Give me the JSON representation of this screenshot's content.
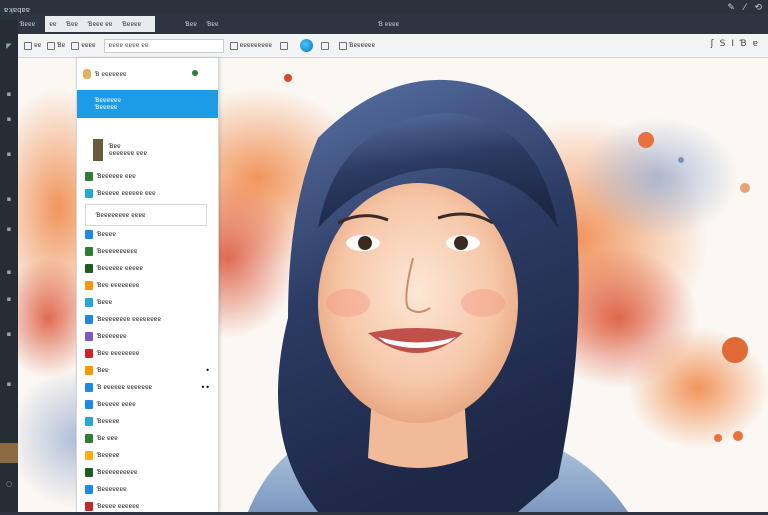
{
  "app": {
    "title": "ɐʞɐqɐɐ"
  },
  "menubar": {
    "items": [
      "Ɓɐɐɐ",
      "Ɓɐɐ",
      "Ɓɐɐ"
    ],
    "tabs": [
      "ɐɐ",
      "Ɓɐɐ",
      "Ɓɐɐɐ ɐɐ",
      "Ɓɐɐɐɐ"
    ],
    "extra": "Ɓ ɐɐɐɐ"
  },
  "toolbar": {
    "items": [
      "ɐɐ",
      "Ɓɐ",
      "ɐɐɐɐ",
      "ɐɐɐɐɐɐɐɐɐ",
      "Ɓɐɐɐɐɐɐ"
    ],
    "search_value": "ɐɐɐɐ ɐɐɐɐ ɐɐ",
    "right_icons": [
      "ʃ",
      "S",
      "I",
      "Ɓ",
      "ɐ"
    ]
  },
  "layers": {
    "header": "Ɓ ɐɐɐɐɐɐɐ",
    "selected": {
      "line1": "Ɓɐɐɐɐɐɐ",
      "line2": "Ɓɐɐɐɐɐ"
    },
    "group": {
      "line1": "Ɓɐɐ",
      "line2": "ɐɐɐɐɐɐɐ ɐɐɐ"
    },
    "rows": [
      {
        "label": "Ɓɐɐɐɐɐɐ ɐɐɐ",
        "color": "#2e7d32"
      },
      {
        "label": "Ɓɐɐɐɐɐ ɐɐɐɐɐɐ ɐɐɐ",
        "color": "#2aa5d8"
      }
    ],
    "subpanel": "Ɓɐɐɐɐɐɐɐɐ ɐɐɐɐ",
    "items": [
      {
        "label": "Ɓɐɐɐɐ",
        "color": "#1e88e5",
        "dots": ""
      },
      {
        "label": "Ɓɐɐɐɐɐɐɐɐɐɐ",
        "color": "#2e7d32",
        "dots": ""
      },
      {
        "label": "Ɓɐɐɐɐɐɐ ɐɐɐɐɐ",
        "color": "#1b5e20",
        "dots": ""
      },
      {
        "label": "Ɓɐɐ ɐɐɐɐɐɐɐɐ",
        "color": "#ff9800",
        "dots": ""
      },
      {
        "label": "Ɓɐɐɐ",
        "color": "#2aa5d8",
        "dots": ""
      },
      {
        "label": "Ɓɐɐɐɐɐɐɐɐ ɐɐɐɐɐɐɐɐ",
        "color": "#1e88e5",
        "dots": ""
      },
      {
        "label": "Ɓɐɐɐɐɐɐɐ",
        "color": "#7e57c2",
        "dots": ""
      },
      {
        "label": "Ɓɐɐ ɐɐɐɐɐɐɐɐ",
        "color": "#c62828",
        "dots": ""
      },
      {
        "label": "Ɓɐɐ",
        "color": "#ff9800",
        "dots": "•"
      },
      {
        "label": "Ɓ ɐɐɐɐɐɐ ɐɐɐɐɐɐɐ",
        "color": "#1e88e5",
        "dots": "••"
      },
      {
        "label": "Ɓɐɐɐɐɐ ɐɐɐɐ",
        "color": "#1e88e5",
        "dots": ""
      },
      {
        "label": "Ɓɐɐɐɐɐ",
        "color": "#2aa5d8",
        "dots": ""
      },
      {
        "label": "Ɓɐ ɐɐɐ",
        "color": "#2e7d32",
        "dots": ""
      },
      {
        "label": "Ɓɐɐɐɐɐ",
        "color": "#ffb300",
        "dots": ""
      },
      {
        "label": "Ɓɐɐɐɐɐɐɐɐɐɐ",
        "color": "#1b5e20",
        "dots": ""
      },
      {
        "label": "Ɓɐɐɐɐɐɐɐ",
        "color": "#1e88e5",
        "dots": ""
      },
      {
        "label": "Ɓɐɐɐɐ ɐɐɐɐɐɐ",
        "color": "#c62828",
        "dots": ""
      }
    ]
  },
  "colors": {
    "accent": "#1e9be6",
    "titlebar": "#2a333c",
    "toolbar": "#f2f3f5"
  }
}
